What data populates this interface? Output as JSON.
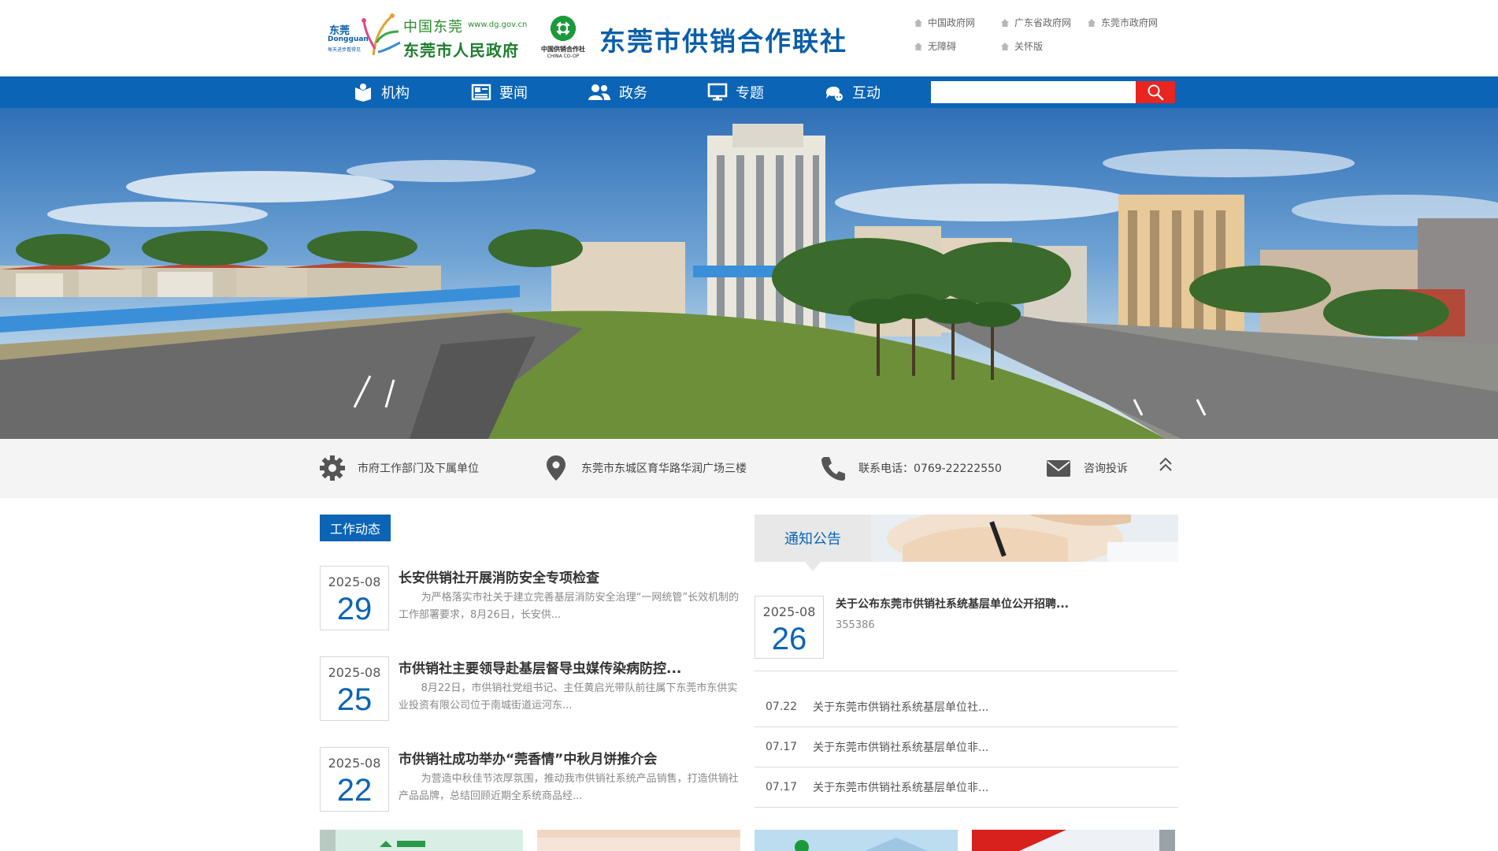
{
  "header": {
    "dongguan_logo": {
      "script_text": "中国东莞",
      "url": "www.dg.gov.cn",
      "name": "东莞市人民政府",
      "badge_cn": "东莞",
      "badge_en": "Dongguan",
      "badge_slogan": "每天进步看得见"
    },
    "coop_logo": {
      "cn": "中国供销合作社",
      "en": "CHINA CO-OP"
    },
    "site_title": "东莞市供销合作联社",
    "top_links": [
      {
        "label": "中国政府网"
      },
      {
        "label": "广东省政府网"
      },
      {
        "label": "东莞市政府网"
      },
      {
        "label": "无障碍"
      },
      {
        "label": "关怀版"
      }
    ]
  },
  "nav": {
    "items": [
      {
        "label": "机构",
        "icon": "book-icon"
      },
      {
        "label": "要闻",
        "icon": "newspaper-icon"
      },
      {
        "label": "政务",
        "icon": "people-icon"
      },
      {
        "label": "专题",
        "icon": "monitor-icon"
      },
      {
        "label": "互动",
        "icon": "chat-icon"
      }
    ],
    "search_placeholder": ""
  },
  "info_bar": {
    "items": [
      {
        "label": "市府工作部门及下属单位",
        "icon": "gear-icon"
      },
      {
        "label": "东莞市东城区育华路华润广场三楼",
        "icon": "location-pin-icon"
      },
      {
        "label": "联系电话：0769-22222550",
        "icon": "phone-icon"
      },
      {
        "label": "咨询投诉",
        "icon": "mail-icon"
      }
    ]
  },
  "work_news": {
    "heading": "工作动态",
    "items": [
      {
        "ym": "2025-08",
        "day": "29",
        "title": "长安供销社开展消防安全专项检查",
        "summary": "为严格落实市社关于建立完善基层消防安全治理“一网统管”长效机制的工作部署要求，8月26日，长安供..."
      },
      {
        "ym": "2025-08",
        "day": "25",
        "title": "市供销社主要领导赴基层督导虫媒传染病防控...",
        "summary": "8月22日，市供销社党组书记、主任黄启光带队前往属下东莞市东供实业投资有限公司位于南城街道运河东..."
      },
      {
        "ym": "2025-08",
        "day": "22",
        "title": "市供销社成功举办“莞香情”中秋月饼推介会",
        "summary": "为营造中秋佳节浓厚氛围，推动我市供销社系统产品销售，打造供销社产品品牌，总结回顾近期全系统商品经..."
      }
    ]
  },
  "notices": {
    "heading": "通知公告",
    "featured": {
      "ym": "2025-08",
      "day": "26",
      "title": "关于公布东莞市供销社系统基层单位公开招聘...",
      "sub": "355386"
    },
    "items": [
      {
        "date": "07.22",
        "title": "关于东莞市供销社系统基层单位社..."
      },
      {
        "date": "07.17",
        "title": "关于东莞市供销社系统基层单位非..."
      },
      {
        "date": "07.17",
        "title": "关于东莞市供销社系统基层单位非..."
      }
    ]
  },
  "colors": {
    "brand_blue": "#0b64b5",
    "search_red": "#e8251f",
    "logo_green": "#1d7d2c"
  }
}
